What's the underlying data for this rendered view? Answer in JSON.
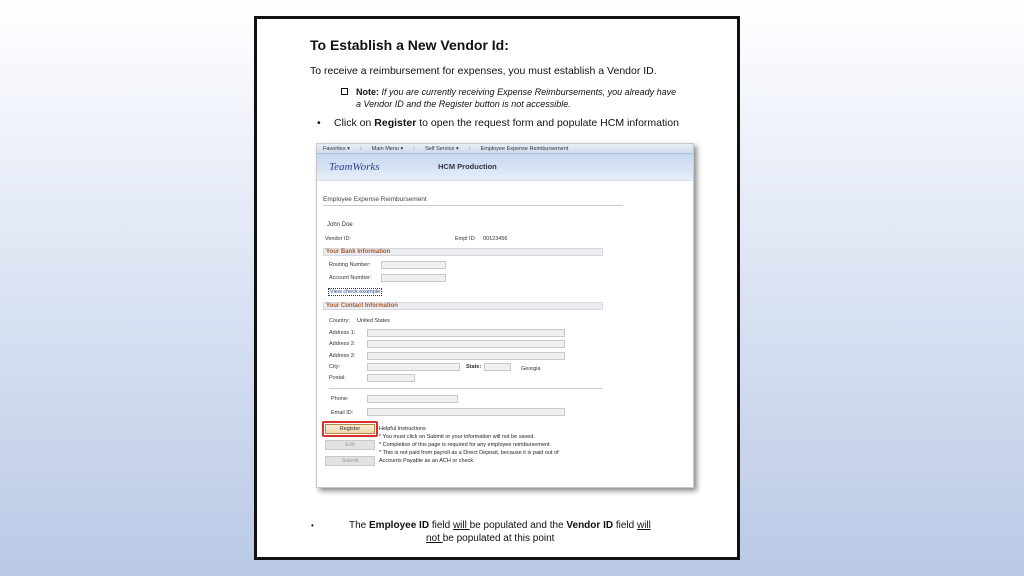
{
  "document": {
    "title": "To Establish a New Vendor Id:",
    "intro": "To receive a reimbursement for expenses, you must establish a Vendor ID.",
    "note_label": "Note:",
    "note_text": "If you are currently receiving Expense Reimbursements, you already have a Vendor ID and the Register button is not accessible.",
    "bullet_prefix": "Click on ",
    "bullet_bold": "Register",
    "bullet_suffix": " to open the request form and populate HCM information",
    "footer": {
      "p1": "The ",
      "b1": "Employee ID",
      "p2": " field ",
      "u1": "will ",
      "p3": "be populated and the ",
      "b2": "Vendor ID",
      "p4": " field ",
      "u2": "will",
      "u3": "not ",
      "p5": "be populated at this point"
    }
  },
  "app": {
    "nav": [
      "Favorites ▾",
      "Main Menu ▾",
      "Self Service ▾",
      "Employee Expense Reimbursement"
    ],
    "nav_sep": "›",
    "brand": "TeamWorks",
    "environment": "HCM Production",
    "page_title": "Employee Expense Reimbursement",
    "employee_name": "John Doe",
    "vendor_id_label": "Vendor ID:",
    "empl_id_label": "Empl ID:",
    "empl_id_value": "00123456",
    "bank_section": "Your Bank Information",
    "routing_label": "Routing Number:",
    "account_label": "Account Number:",
    "view_check_link": "View check example",
    "contact_section": "Your Contact Information",
    "country_label": "Country:",
    "country_value": "United States",
    "address1_label": "Address 1:",
    "address2_label": "Address 2:",
    "address3_label": "Address 3:",
    "city_label": "City:",
    "state_label": "State:",
    "state_value": "Georgia",
    "postal_label": "Postal:",
    "phone_label": "Phone:",
    "email_label": "Email ID:",
    "register_button": "Register",
    "edit_button": "Edit",
    "submit_button": "Submit",
    "help_title": "Helpful Instructions",
    "help_lines": [
      "* You must click on Submit or your information will not be saved.",
      "* Completion of this page is required for any employee reimbursement.",
      "* This is not paid from payroll as a Direct Deposit, because it is paid out of",
      "Accounts Payable as an ACH or check."
    ]
  }
}
